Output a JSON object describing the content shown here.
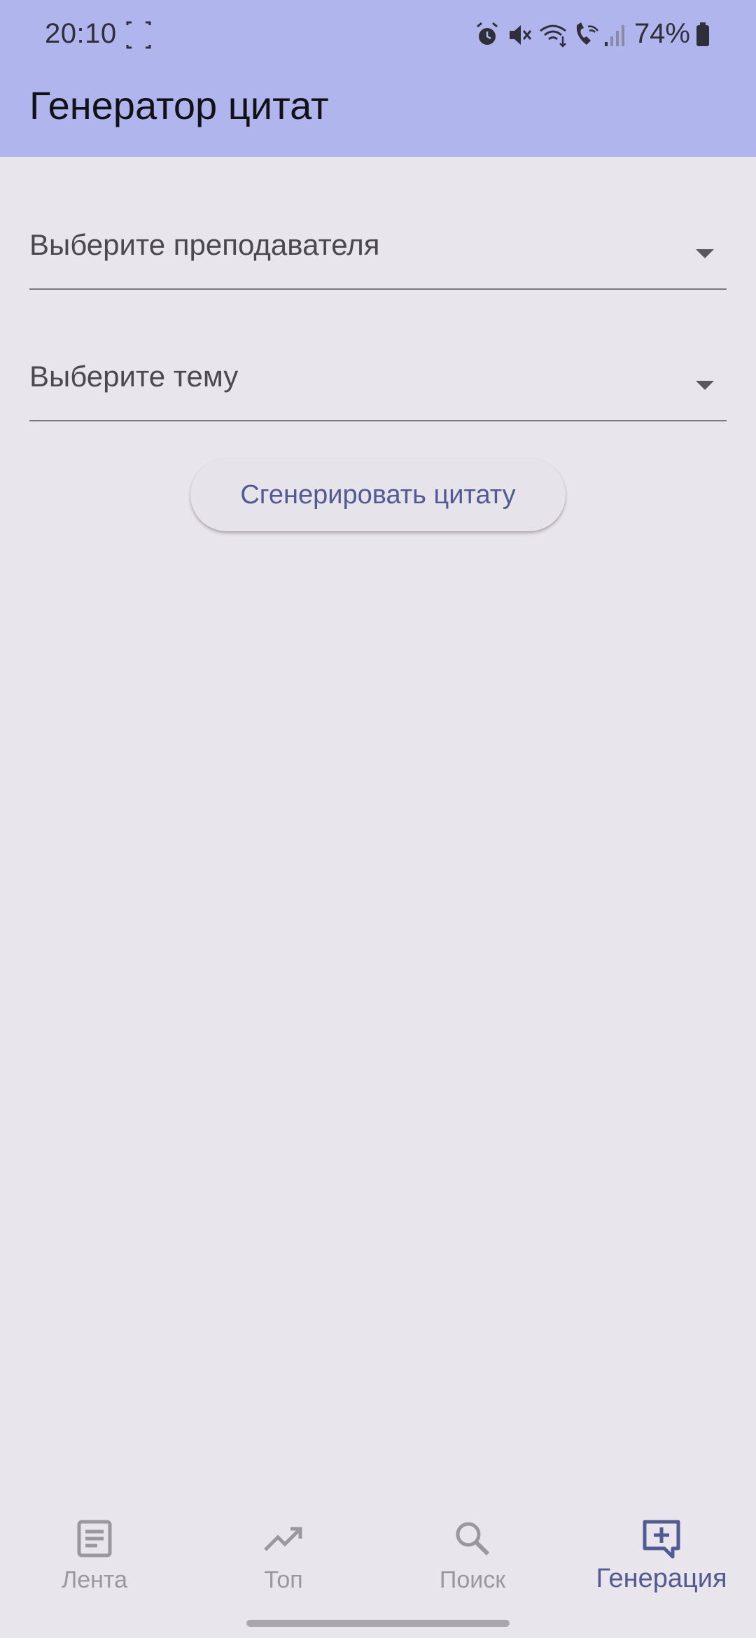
{
  "status_bar": {
    "time": "20:10",
    "battery_percent": "74%",
    "icons": [
      "screenshot-frame-icon",
      "alarm-icon",
      "mute-icon",
      "wifi-data-icon",
      "wifi-calling-icon",
      "signal-icon",
      "battery-icon"
    ]
  },
  "app_bar": {
    "title": "Генератор цитат",
    "background": "#b0b5ee"
  },
  "form": {
    "teacher_select": {
      "placeholder": "Выберите преподавателя"
    },
    "topic_select": {
      "placeholder": "Выберите тему"
    },
    "generate_button": {
      "label": "Сгенерировать цитату"
    }
  },
  "bottom_nav": {
    "items": [
      {
        "label": "Лента",
        "icon": "feed-icon",
        "active": false
      },
      {
        "label": "Топ",
        "icon": "trending-icon",
        "active": false
      },
      {
        "label": "Поиск",
        "icon": "search-icon",
        "active": false
      },
      {
        "label": "Генерация",
        "icon": "add-comment-icon",
        "active": true
      }
    ],
    "active_color": "#525a93",
    "inactive_color": "#9a979e"
  }
}
